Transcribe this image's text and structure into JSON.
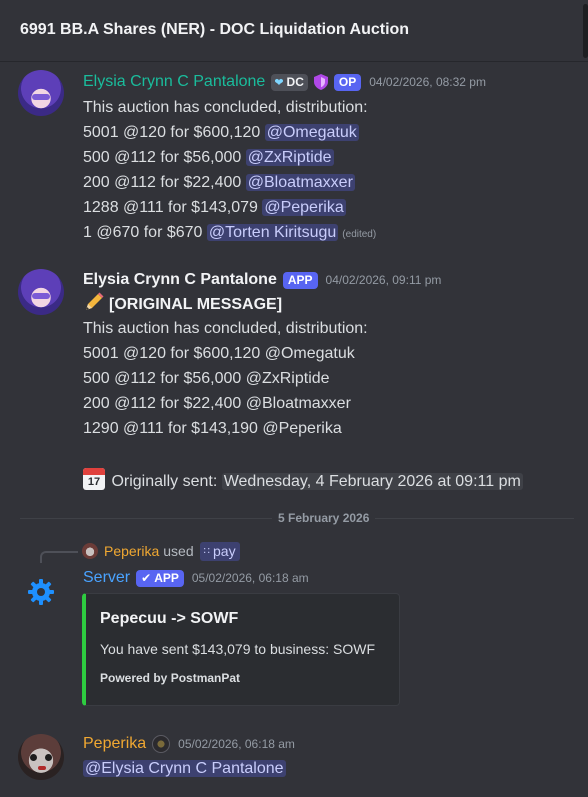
{
  "channel": {
    "title": "6991 BB.A Shares (NER) - DOC Liquidation Auction"
  },
  "messages": [
    {
      "author": "Elysia Crynn C Pantalone",
      "guild_tag": "DC",
      "op_tag": "OP",
      "timestamp": "04/02/2026, 08:32 pm",
      "lines": [
        {
          "text": "This auction has concluded, distribution:"
        },
        {
          "text": "5001 @120 for $600,120 ",
          "mention": "@Omegatuk"
        },
        {
          "text": "500 @112 for $56,000 ",
          "mention": "@ZxRiptide"
        },
        {
          "text": "200 @112 for $22,400 ",
          "mention": "@Bloatmaxxer"
        },
        {
          "text": "1288 @111 for $143,079 ",
          "mention": "@Peperika"
        },
        {
          "text": "1 @670 for $670 ",
          "mention": "@Torten Kiritsugu",
          "edited": "(edited)"
        }
      ]
    },
    {
      "author": "Elysia Crynn C Pantalone",
      "app_tag": "APP",
      "timestamp": "04/02/2026, 09:11 pm",
      "heading": "[ORIGINAL MESSAGE]",
      "lines": [
        {
          "text": "This auction has concluded, distribution:"
        },
        {
          "text": "5001 @120 for $600,120 @Omegatuk"
        },
        {
          "text": "500 @112 for $56,000 @ZxRiptide"
        },
        {
          "text": "200 @112 for $22,400 @Bloatmaxxer"
        },
        {
          "text": "1290 @111 for $143,190 @Peperika"
        }
      ],
      "calendar_day": "17",
      "sent_label": "Originally sent: ",
      "sent_time": "Wednesday, 4 February 2026 at 09:11 pm"
    },
    {
      "reply_user": "Peperika",
      "reply_used": "used",
      "command": "pay",
      "author": "Server",
      "app_tag": "APP",
      "timestamp": "05/02/2026, 06:18 am",
      "embed": {
        "title": "Pepecuu -> SOWF",
        "description": "You have sent $143,079 to business: SOWF",
        "footer": "Powered by PostmanPat",
        "accent": "#2ecc40"
      }
    },
    {
      "author": "Peperika",
      "timestamp": "05/02/2026, 06:18 am",
      "mention": "@Elysia Crynn C Pantalone"
    }
  ],
  "date_divider": "5 February 2026",
  "colors": {
    "background": "#323339",
    "mention_bg": "#3e4370",
    "blurple": "#5865f2",
    "teal_name": "#1abc9c",
    "orange_name": "#f0a832",
    "server_name": "#4aa3ff"
  },
  "icons": [
    "heart-icon",
    "shield-icon",
    "pencil-icon",
    "calendar-icon",
    "gear-icon",
    "check-icon",
    "command-icon"
  ]
}
